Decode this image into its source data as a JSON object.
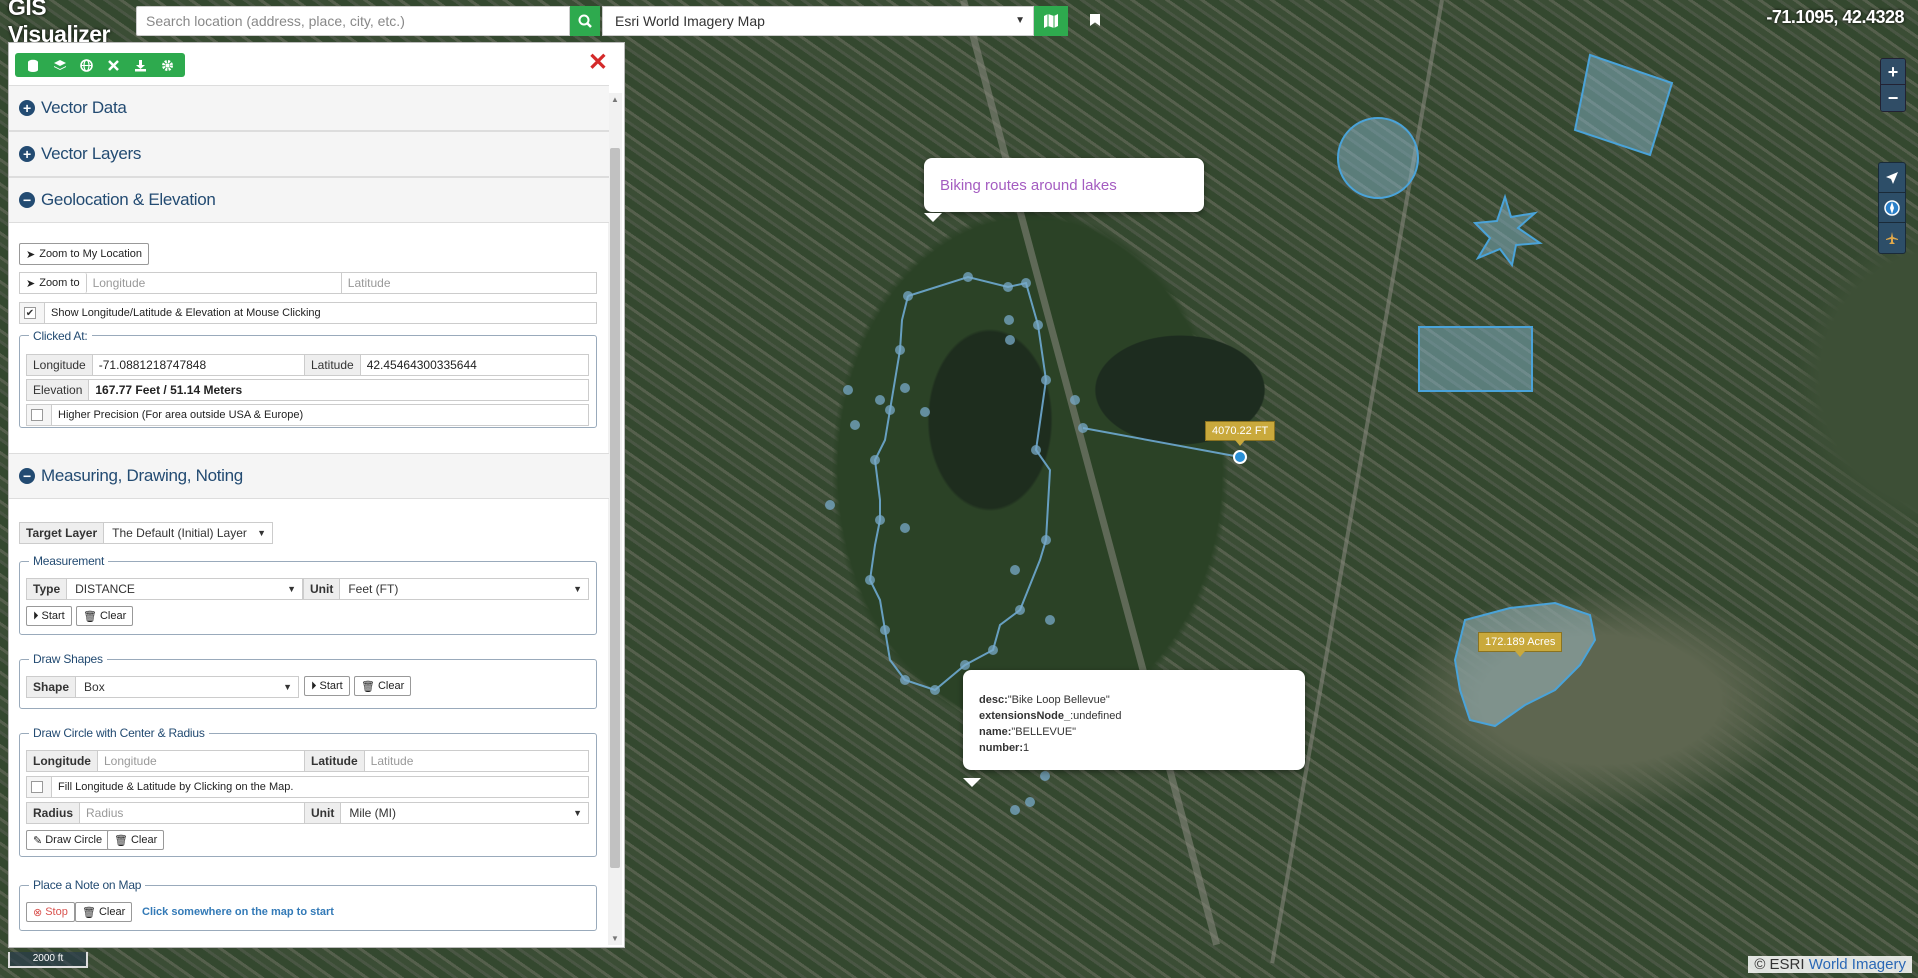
{
  "app": {
    "title": "GIS Visualizer",
    "coordinates": "-71.1095, 42.4328"
  },
  "search": {
    "placeholder": "Search location (address, place, city, etc.)"
  },
  "basemap": {
    "selected": "Esri World Imagery Map"
  },
  "map_controls": {
    "zoom_in": "+",
    "zoom_out": "−"
  },
  "panel": {
    "toolbar_icons": [
      "database-icon",
      "layers-icon",
      "globe-icon",
      "tools-icon",
      "download-icon",
      "gear-icon"
    ],
    "close_icon": "close-icon",
    "sections": {
      "vector_data": "Vector Data",
      "vector_layers": "Vector Layers",
      "geolocation": "Geolocation & Elevation",
      "measuring": "Measuring, Drawing, Noting"
    },
    "geo": {
      "zoom_my_location": "Zoom to My Location",
      "zoom_to": "Zoom to",
      "longitude_placeholder": "Longitude",
      "latitude_placeholder": "Latitude",
      "show_checkbox": "Show Longitude/Latitude & Elevation at Mouse Clicking",
      "show_checked": true,
      "clicked_at": "Clicked At:",
      "longitude_label": "Longitude",
      "longitude_value": "-71.0881218747848",
      "latitude_label": "Latitude",
      "latitude_value": "42.45464300335644",
      "elevation_label": "Elevation",
      "elevation_value": "167.77 Feet / 51.14 Meters",
      "higher_precision": "Higher Precision (For area outside USA & Europe)"
    },
    "measure": {
      "target_layer_label": "Target Layer",
      "target_layer_value": "The Default (Initial) Layer",
      "measurement_legend": "Measurement",
      "type_label": "Type",
      "type_value": "DISTANCE",
      "unit_label": "Unit",
      "unit_value": "Feet (FT)",
      "start": "Start",
      "clear": "Clear",
      "draw_shapes_legend": "Draw Shapes",
      "shape_label": "Shape",
      "shape_value": "Box",
      "circle_legend": "Draw Circle with Center & Radius",
      "longitude_label": "Longitude",
      "longitude_placeholder": "Longitude",
      "latitude_label": "Latitude",
      "latitude_placeholder": "Latitude",
      "fill_checkbox": "Fill Longitude & Latitude by Clicking on the Map.",
      "radius_label": "Radius",
      "radius_placeholder": "Radius",
      "circle_unit_label": "Unit",
      "circle_unit_value": "Mile (MI)",
      "draw_circle": "Draw Circle",
      "note_legend": "Place a Note on Map",
      "stop": "Stop",
      "note_hint": "Click somewhere on the map to start"
    }
  },
  "map": {
    "note_popup": "Biking routes around lakes",
    "distance_tag": "4070.22 FT",
    "area_tag": "172.189 Acres",
    "feature_popup": [
      {
        "key": "desc:",
        "value": "\"Bike Loop Bellevue\""
      },
      {
        "key": "extensionsNode_",
        "value": ":undefined"
      },
      {
        "key": "name:",
        "value": "\"BELLEVUE\""
      },
      {
        "key": "number:",
        "value": "1"
      }
    ],
    "scale": "2000 ft",
    "attribution_prefix": "© ESRI",
    "attribution_link": "World Imagery"
  }
}
